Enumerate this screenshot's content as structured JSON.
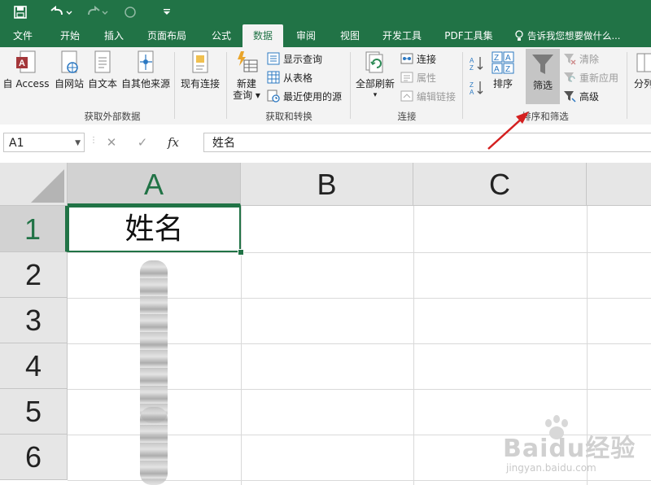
{
  "qat": {
    "save_icon": "save-icon",
    "undo_icon": "undo-icon",
    "redo_icon": "redo-icon",
    "touch_icon": "touch-mode-icon",
    "customize_icon": "customize-qat-icon"
  },
  "tabs": [
    {
      "label": "文件"
    },
    {
      "label": "开始"
    },
    {
      "label": "插入"
    },
    {
      "label": "页面布局"
    },
    {
      "label": "公式"
    },
    {
      "label": "数据"
    },
    {
      "label": "审阅"
    },
    {
      "label": "视图"
    },
    {
      "label": "开发工具"
    },
    {
      "label": "PDF工具集"
    }
  ],
  "tell_me": "告诉我您想要做什么...",
  "ribbon": {
    "get_external": {
      "label": "获取外部数据",
      "from_access": "自 Access",
      "from_web": "自网站",
      "from_text": "自文本",
      "from_other": "自其他来源",
      "existing": "现有连接"
    },
    "get_transform": {
      "label": "获取和转换",
      "new_query_1": "新建",
      "new_query_2": "查询",
      "show_queries": "显示查询",
      "from_table": "从表格",
      "recent_sources": "最近使用的源"
    },
    "connections": {
      "label": "连接",
      "refresh_all": "全部刷新",
      "connections": "连接",
      "properties": "属性",
      "edit_links": "编辑链接"
    },
    "sort_filter": {
      "label": "排序和筛选",
      "sort": "排序",
      "filter": "筛选",
      "clear": "清除",
      "reapply": "重新应用",
      "advanced": "高级"
    },
    "more": "分列"
  },
  "formula_bar": {
    "name_box": "A1",
    "cancel": "✕",
    "enter": "✓",
    "fx": "fx",
    "value": "姓名"
  },
  "columns": [
    "A",
    "B",
    "C"
  ],
  "rows": [
    "1",
    "2",
    "3",
    "4",
    "5",
    "6"
  ],
  "cells": {
    "A1": "姓名"
  },
  "watermark": {
    "text": "Baidu经验",
    "url": "jingyan.baidu.com"
  },
  "accent": "#217346",
  "arrow_color": "#d42020"
}
